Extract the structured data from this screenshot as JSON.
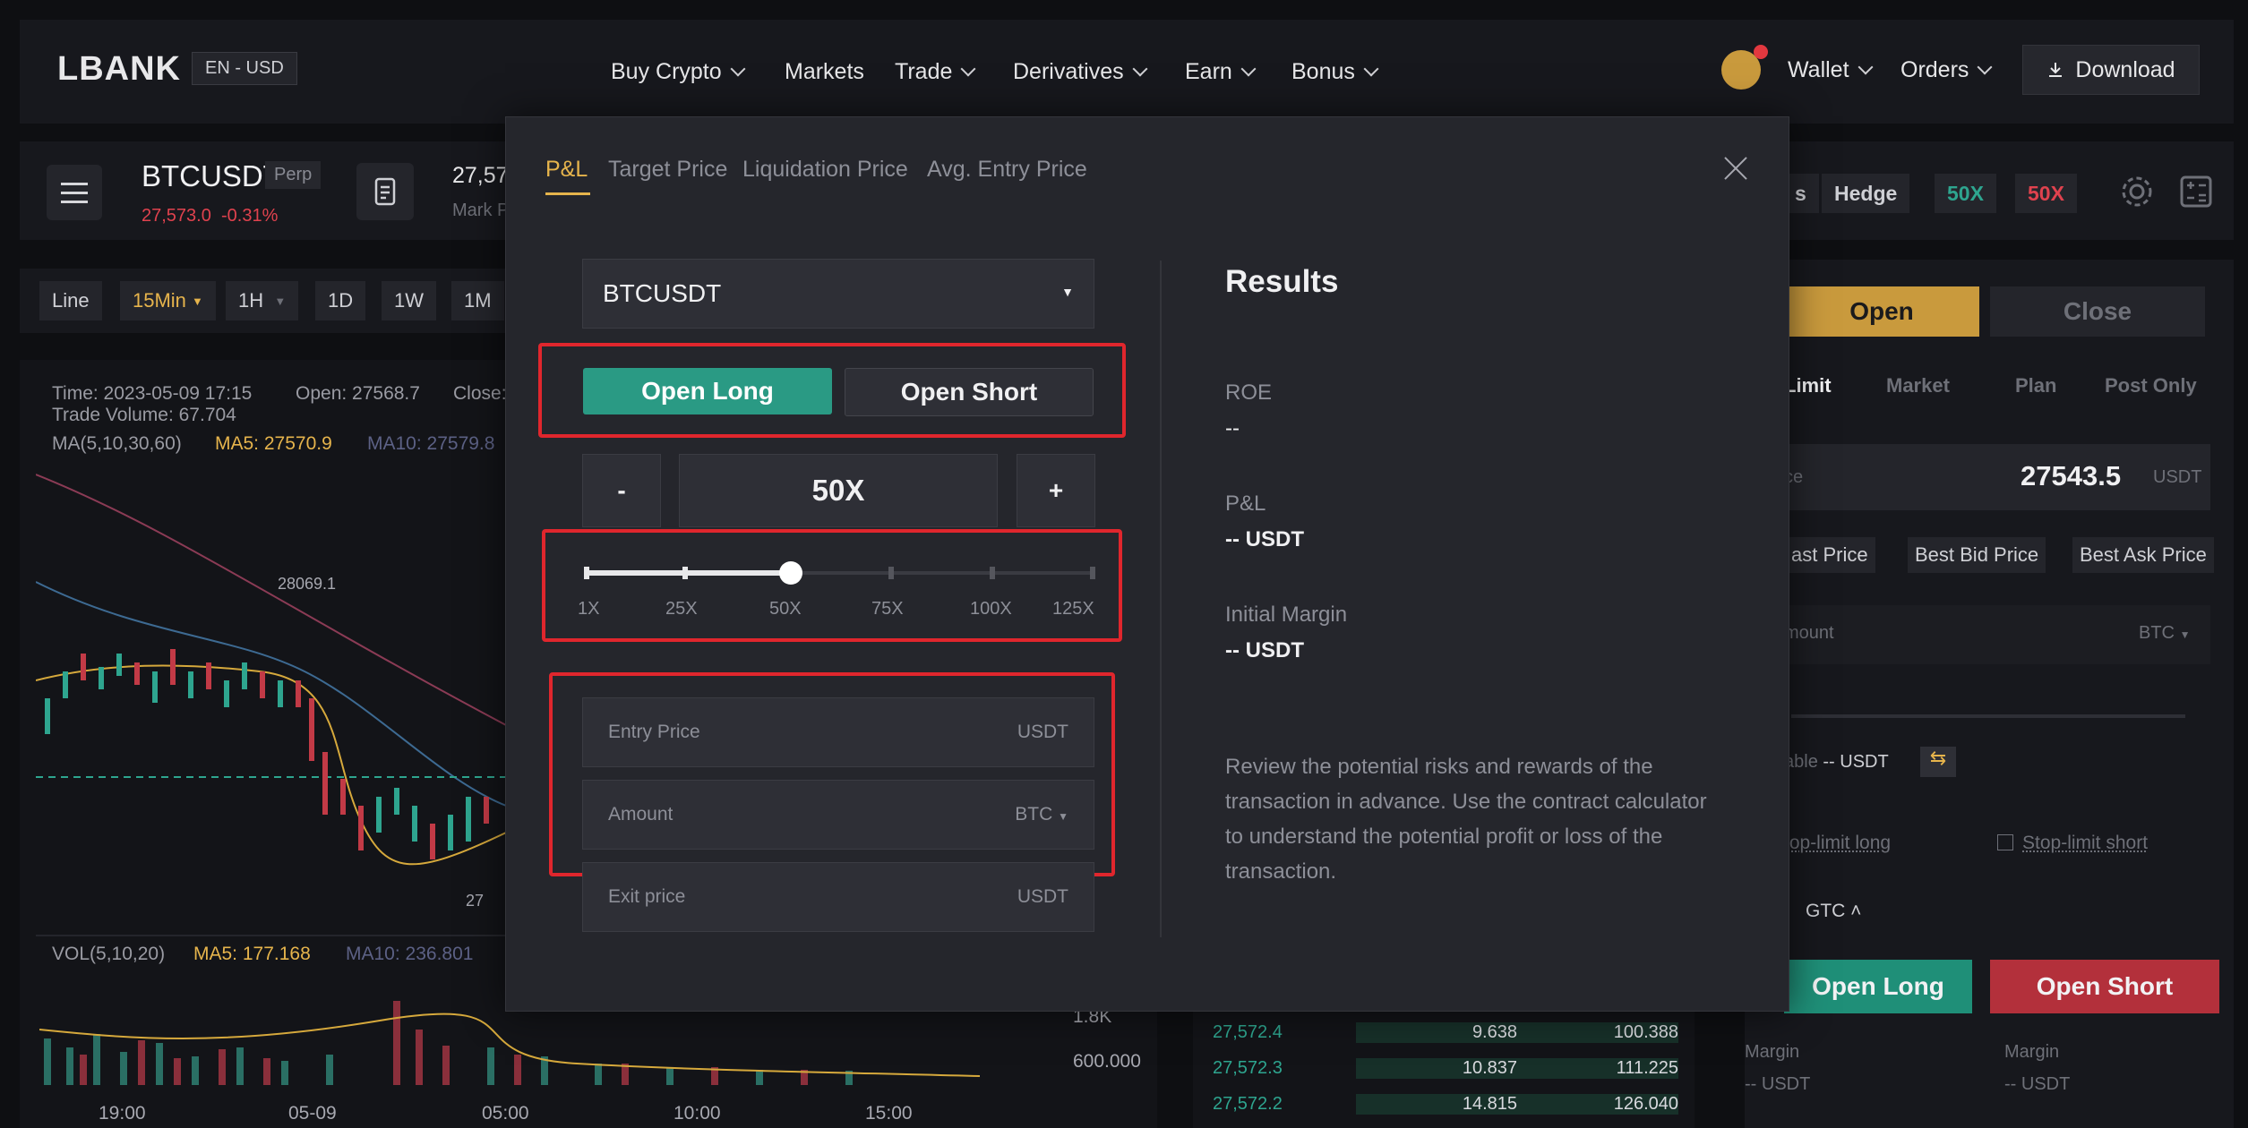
{
  "brand": {
    "logo": "LBANK",
    "lang": "EN - USD"
  },
  "nav": {
    "items": [
      "Buy Crypto",
      "Markets",
      "Trade",
      "Derivatives",
      "Earn",
      "Bonus"
    ],
    "wallet": "Wallet",
    "orders": "Orders",
    "download": "Download"
  },
  "ticker": {
    "symbol": "BTCUSDT",
    "tag": "Perp",
    "price": "27,573.0",
    "change": "-0.31%",
    "mark_price": "27,57",
    "mark_label": "Mark P"
  },
  "header_right": {
    "mode_partial": "s",
    "hedge": "Hedge",
    "lev_long": "50X",
    "lev_short": "50X"
  },
  "timeframes": {
    "line": "Line",
    "tf15": "15Min",
    "tf1h": "1H",
    "d1": "1D",
    "w1": "1W",
    "m1": "1M"
  },
  "chart_info": {
    "time": "Time: 2023-05-09 17:15",
    "open": "Open: 27568.7",
    "close": "Close:",
    "volume": "Trade Volume: 67.704",
    "ma_label": "MA(5,10,30,60)",
    "ma5": "MA5: 27570.9",
    "ma10": "MA10: 27579.8",
    "high_mark": "28069.1",
    "low_mark": "27",
    "vol_label": "VOL(5,10,20)",
    "vol_ma5": "MA5: 177.168",
    "vol_ma10": "MA10: 236.801",
    "vol_axis_1": "1.8K",
    "vol_axis_2": "600.000",
    "x_labels": [
      "19:00",
      "05-09",
      "05:00",
      "10:00",
      "15:00"
    ]
  },
  "order_panel": {
    "tab_open": "Open",
    "tab_close": "Close",
    "order_types": [
      "Limit",
      "Market",
      "Plan",
      "Post Only"
    ],
    "price_label": "ce",
    "price_value": "27543.5",
    "price_unit": "USDT",
    "quick_prices": [
      "ast Price",
      "Best Bid Price",
      "Best Ask Price"
    ],
    "amount_label": "mount",
    "amount_unit": "BTC",
    "available_label": "able",
    "available_value": "-- USDT",
    "stop_long": "top-limit long",
    "stop_short": "Stop-limit short",
    "tif": "GTC",
    "open_long": "Open Long",
    "open_short": "Open Short",
    "margin_label": "Margin",
    "margin_value": "-- USDT"
  },
  "orderbook": {
    "rows": [
      {
        "price": "27,572.4",
        "size": "9.638",
        "total": "100.388"
      },
      {
        "price": "27,572.3",
        "size": "10.837",
        "total": "111.225"
      },
      {
        "price": "27,572.2",
        "size": "14.815",
        "total": "126.040"
      }
    ]
  },
  "modal": {
    "tabs": [
      "P&L",
      "Target Price",
      "Liquidation Price",
      "Avg. Entry Price"
    ],
    "symbol": "BTCUSDT",
    "open_long": "Open Long",
    "open_short": "Open Short",
    "minus": "-",
    "plus": "+",
    "leverage": "50X",
    "leverage_value": 50,
    "slider_labels": [
      "1X",
      "25X",
      "50X",
      "75X",
      "100X",
      "125X"
    ],
    "entry_price": {
      "placeholder": "Entry Price",
      "unit": "USDT"
    },
    "amount": {
      "placeholder": "Amount",
      "unit": "BTC"
    },
    "exit_price": {
      "placeholder": "Exit price",
      "unit": "USDT"
    },
    "results_title": "Results",
    "roe_label": "ROE",
    "roe_value": "--",
    "pnl_label": "P&L",
    "pnl_value": "-- USDT",
    "margin_label": "Initial Margin",
    "margin_value": "-- USDT",
    "note": "Review the potential risks and rewards of the transaction in advance. Use the contract calculator to understand the potential profit or loss of the transaction."
  },
  "colors": {
    "accent": "#e6b44c",
    "long": "#2ea58f",
    "short": "#c23a46",
    "highlight": "#e0262d"
  }
}
